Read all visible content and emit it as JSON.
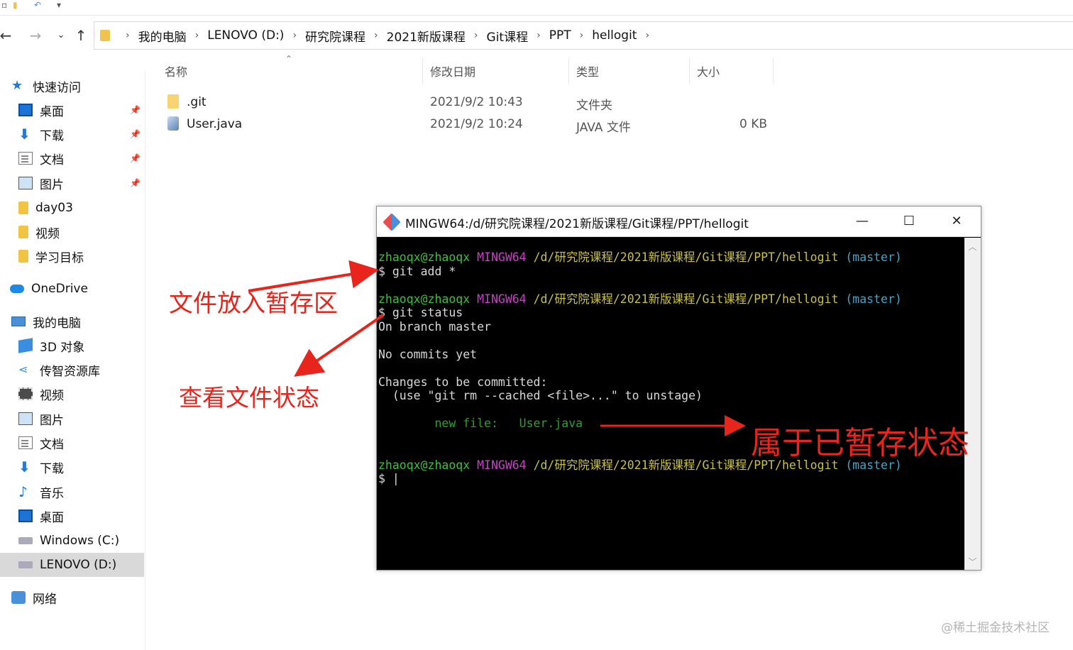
{
  "window": {
    "breadcrumb": [
      "我的电脑",
      "LENOVO (D:)",
      "研究院课程",
      "2021新版课程",
      "Git课程",
      "PPT",
      "hellogit"
    ]
  },
  "nav": {
    "back_icon": "arrow-left-icon",
    "forward_icon": "arrow-right-icon",
    "recent_icon": "chevron-down-icon",
    "up_icon": "arrow-up-icon"
  },
  "sidebar": {
    "quick_access": "快速访问",
    "quick_items": [
      {
        "label": "桌面",
        "pinned": true
      },
      {
        "label": "下载",
        "pinned": true
      },
      {
        "label": "文档",
        "pinned": true
      },
      {
        "label": "图片",
        "pinned": true
      },
      {
        "label": "day03",
        "pinned": false
      },
      {
        "label": "视频",
        "pinned": false
      },
      {
        "label": "学习目标",
        "pinned": false
      }
    ],
    "onedrive": "OneDrive",
    "this_pc": "我的电脑",
    "pc_items": [
      "3D 对象",
      "传智资源库",
      "视频",
      "图片",
      "文档",
      "下载",
      "音乐",
      "桌面",
      "Windows (C:)",
      "LENOVO (D:)"
    ],
    "network": "网络"
  },
  "columns": {
    "name": "名称",
    "modified": "修改日期",
    "type": "类型",
    "size": "大小"
  },
  "files": [
    {
      "name": ".git",
      "modified": "2021/9/2 10:43",
      "type": "文件夹",
      "size": ""
    },
    {
      "name": "User.java",
      "modified": "2021/9/2 10:24",
      "type": "JAVA 文件",
      "size": "0 KB"
    }
  ],
  "terminal": {
    "title": "MINGW64:/d/研究院课程/2021新版课程/Git课程/PPT/hellogit",
    "minimize": "—",
    "maximize": "☐",
    "close": "✕",
    "prompt_user": "zhaoqx@zhaoqx",
    "prompt_env": "MINGW64",
    "prompt_path": "/d/研究院课程/2021新版课程/Git课程/PPT/hellogit",
    "prompt_branch": "(master)",
    "cmd1": "$ git add *",
    "cmd2": "$ git status",
    "out_branch": "On branch master",
    "out_no_commits": "No commits yet",
    "out_changes": "Changes to be committed:",
    "out_hint": "  (use \"git rm --cached <file>...\" to unstage)",
    "out_newfile": "        new file:   User.java",
    "cursor_prompt": "$ |"
  },
  "annotations": {
    "add": "文件放入暂存区",
    "status": "查看文件状态",
    "staged": "属于已暂存状态",
    "color": "#e8251d"
  },
  "watermark": "@稀土掘金技术社区"
}
